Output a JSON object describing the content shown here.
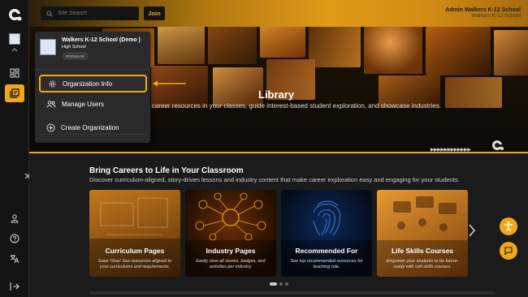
{
  "header": {
    "search_placeholder": "Site Search",
    "join_label": "Join",
    "admin_name": "Admin Walkers K-12 School",
    "admin_school": "Walkers K-12 School"
  },
  "sidebar": {
    "icons": [
      "app-logo-icon",
      "school-avatar",
      "chevron-up-icon",
      "dashboard-icon",
      "library-icon",
      "expand-icon",
      "user-icon",
      "help-icon",
      "language-icon",
      "logout-icon"
    ]
  },
  "hero": {
    "title": "Library",
    "subtitle": "ign career resources in your classes, guide interest-based student exploration, and showcase industries."
  },
  "section": {
    "title": "Bring Careers to Life in Your Classroom",
    "subtitle": "Discover curriculum-aligned, story-driven lessons and industry content that make career exploration easy and engaging for your students."
  },
  "cards": [
    {
      "title": "Curriculum Pages",
      "desc": "Save Time! See resources aligned to your curriculums and requirements."
    },
    {
      "title": "Industry Pages",
      "desc": "Easily view all stories, badges, and activities per industry."
    },
    {
      "title": "Recommended For",
      "desc": "See top recommended resources for teaching role."
    },
    {
      "title": "Life Skills Courses",
      "desc": "Empower your students to be future-ready with soft skills courses."
    }
  ],
  "dropdown": {
    "school_name": "Walkers K-12 School (Demo )",
    "school_level": "High School",
    "badge": "PREMIUM",
    "items": [
      {
        "label": "Organization Info",
        "icon": "gear-icon"
      },
      {
        "label": "Manage Users",
        "icon": "users-icon"
      },
      {
        "label": "Create Organization",
        "icon": "plus-circle-icon"
      }
    ]
  },
  "colors": {
    "accent": "#f2a71b",
    "background": "#1b1b1b",
    "sidebar": "#141414",
    "dropdown": "#2a2a2a"
  }
}
